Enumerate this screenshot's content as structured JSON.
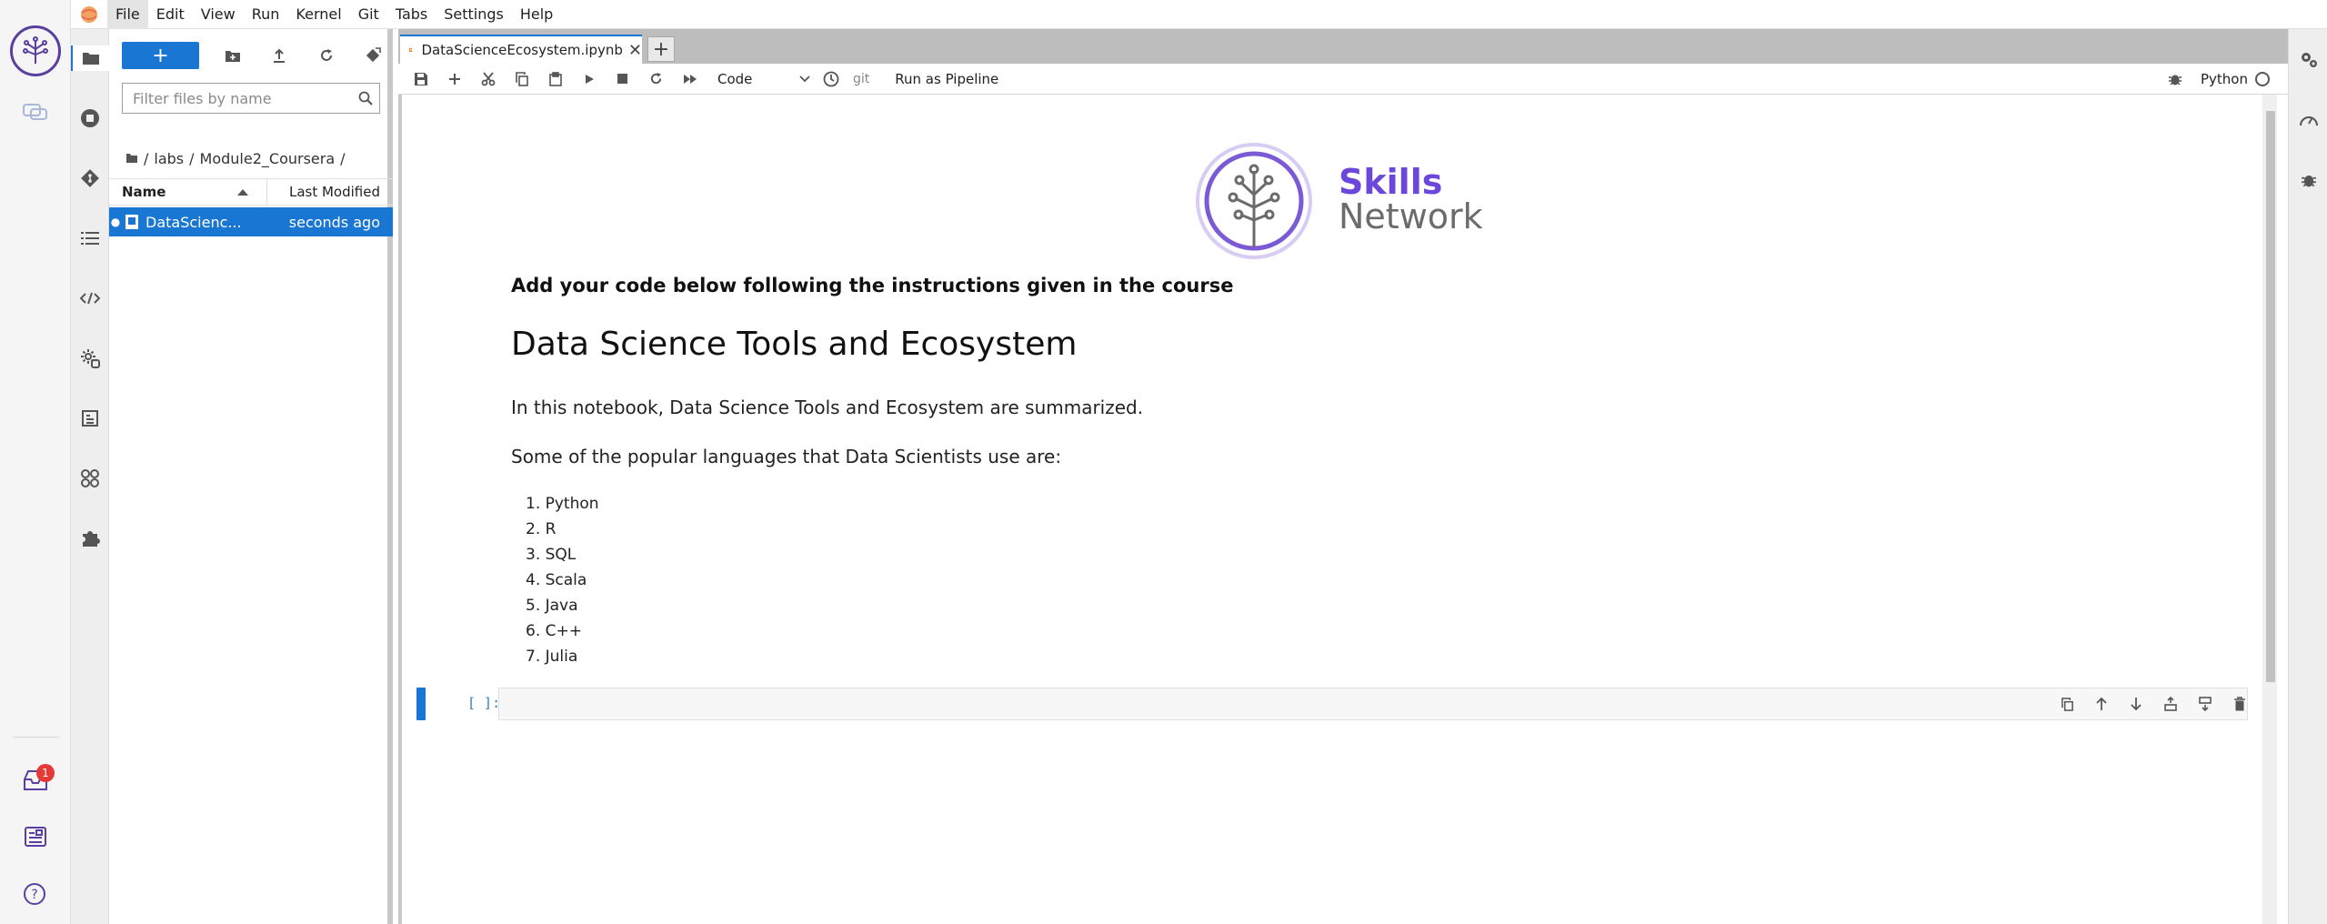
{
  "menubar": {
    "items": [
      "File",
      "Edit",
      "View",
      "Run",
      "Kernel",
      "Git",
      "Tabs",
      "Settings",
      "Help"
    ]
  },
  "skills_network": {
    "inbox_badge": "1"
  },
  "filebrowser": {
    "new_label": "+",
    "search_placeholder": "Filter files by name",
    "breadcrumb": [
      "/",
      "labs",
      "/",
      "Module2_Coursera",
      "/"
    ],
    "columns": {
      "name": "Name",
      "modified": "Last Modified"
    },
    "files": [
      {
        "name": "DataScienc...",
        "modified": "seconds ago"
      }
    ]
  },
  "tabs": [
    {
      "label": "DataScienceEcosystem.ipynb"
    }
  ],
  "notebook_toolbar": {
    "cell_type": "Code",
    "git_label": "git",
    "pipeline_label": "Run as Pipeline",
    "kernel_name": "Python"
  },
  "notebook": {
    "brand_skills": "Skills",
    "brand_network": "Network",
    "instruction": "Add your code below following the instructions given in the course",
    "heading": "Data Science Tools and Ecosystem",
    "intro": "In this notebook, Data Science Tools and Ecosystem are summarized.",
    "languages_intro": "Some of the popular languages that Data Scientists use are:",
    "languages": [
      "1. Python",
      "2. R",
      "3. SQL",
      "4. Scala",
      "5. Java",
      "6. C++",
      "7. Julia"
    ],
    "prompt": "[ ]:"
  },
  "colors": {
    "accent": "#1976d2",
    "brand_purple": "#6b47dc",
    "brand_gray": "#6b6b6b",
    "badge": "#e53935"
  }
}
